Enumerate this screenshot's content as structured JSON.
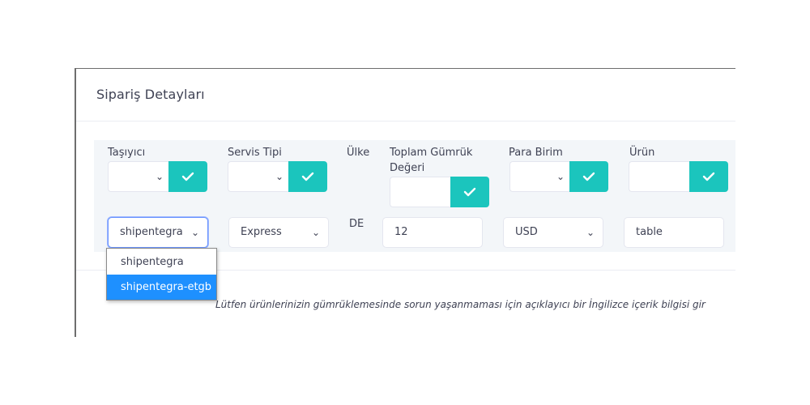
{
  "card": {
    "title": "Sipariş Detayları"
  },
  "columns": {
    "carrier": {
      "label": "Taşıyıcı",
      "value": "shipentegra"
    },
    "service_type": {
      "label": "Servis Tipi",
      "value": "Express"
    },
    "country": {
      "label": "Ülke",
      "value": "DE"
    },
    "customs_value": {
      "label_line1": "Toplam Gümrük",
      "label_line2": "Değeri",
      "value": "12"
    },
    "currency": {
      "label": "Para Birim",
      "value": "USD"
    },
    "product": {
      "label": "Ürün",
      "value": "table"
    }
  },
  "dropdown": {
    "options": [
      "shipentegra",
      "shipentegra-etgb"
    ],
    "highlighted": "shipentegra-etgb"
  },
  "note": "Lütfen ürünlerinizin gümrüklemesinde sorun yaşanmaması için açıklayıcı bir İngilizce içerik bilgisi gir",
  "colors": {
    "accent": "#1bc5bd",
    "highlight": "#1e90ff",
    "panel": "#f3f6f9"
  },
  "icons": {
    "confirm": "check-icon",
    "select": "chevron-down-icon"
  }
}
